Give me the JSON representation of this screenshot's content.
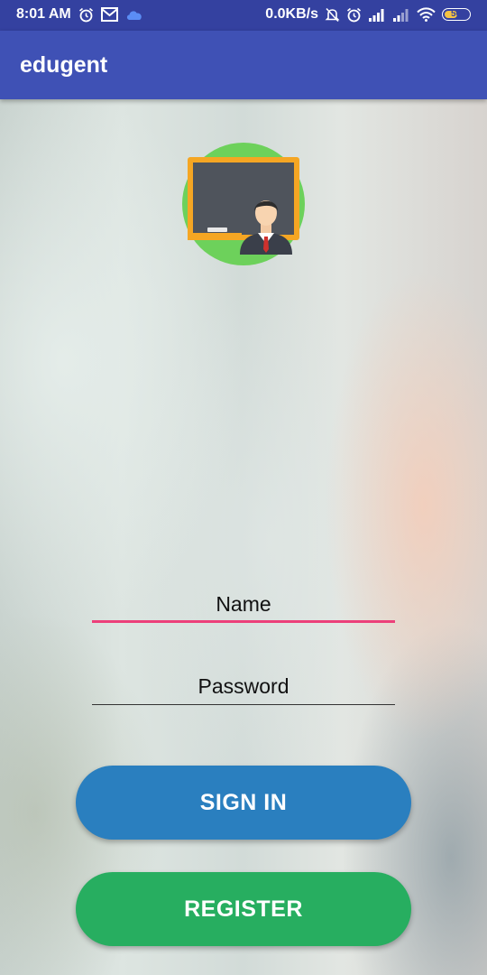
{
  "status_bar": {
    "time": "8:01 AM",
    "network_speed": "0.0KB/s",
    "battery": "50",
    "icons": [
      "alarm-icon",
      "gmail-icon",
      "cloud-icon",
      "mute-icon",
      "alarm-icon",
      "signal-icon",
      "signal-icon",
      "wifi-icon",
      "battery-icon"
    ]
  },
  "app_bar": {
    "title": "edugent"
  },
  "logo": {
    "icon": "teacher-blackboard-icon"
  },
  "form": {
    "name_placeholder": "Name",
    "name_value": "",
    "password_placeholder": "Password",
    "password_value": ""
  },
  "buttons": {
    "sign_in": "SIGN IN",
    "register": "REGISTER"
  },
  "colors": {
    "status_bar": "#3441a0",
    "app_bar": "#3f51b5",
    "sign_in": "#2a7fbf",
    "register": "#27ae60",
    "focus_underline": "#ec407a"
  }
}
